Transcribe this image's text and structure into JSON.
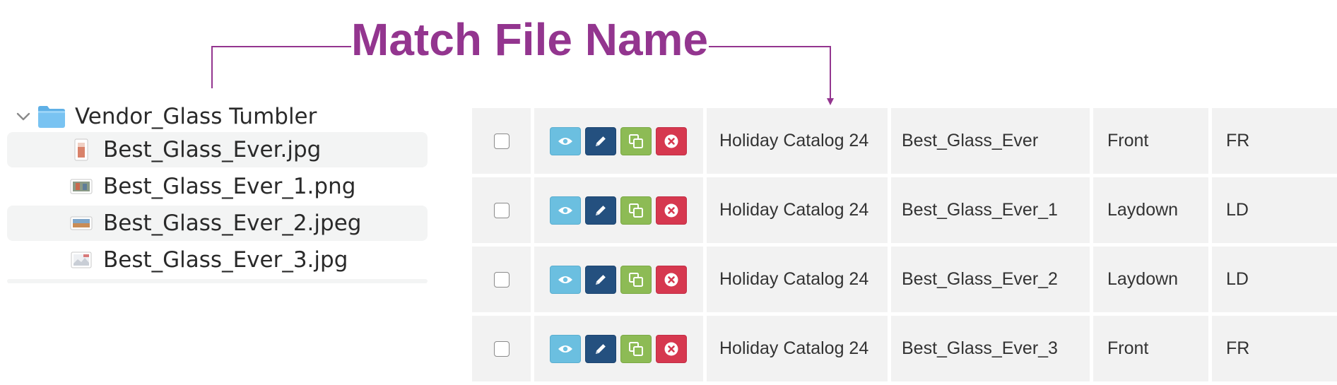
{
  "annotation": {
    "title": "Match File Name",
    "color": "#93358f"
  },
  "finder": {
    "folder": {
      "name": "Vendor_Glass Tumbler",
      "icon": "folder-icon",
      "expanded": true
    },
    "files": [
      {
        "name": "Best_Glass_Ever.jpg",
        "icon": "image-thumbnail-icon"
      },
      {
        "name": "Best_Glass_Ever_1.png",
        "icon": "image-thumbnail-icon"
      },
      {
        "name": "Best_Glass_Ever_2.jpeg",
        "icon": "image-thumbnail-icon"
      },
      {
        "name": "Best_Glass_Ever_3.jpg",
        "icon": "image-thumbnail-icon"
      }
    ]
  },
  "table": {
    "action_icons": [
      "eye-icon",
      "pencil-icon",
      "copy-icon",
      "close-circle-icon"
    ],
    "action_colors": {
      "view": "#6bbfe0",
      "edit": "#24507f",
      "copy": "#8dbb55",
      "delete": "#d6384f"
    },
    "rows": [
      {
        "catalog": "Holiday Catalog 24",
        "file_name": "Best_Glass_Ever",
        "view": "Front",
        "code": "FR"
      },
      {
        "catalog": "Holiday Catalog 24",
        "file_name": "Best_Glass_Ever_1",
        "view": "Laydown",
        "code": "LD"
      },
      {
        "catalog": "Holiday Catalog 24",
        "file_name": "Best_Glass_Ever_2",
        "view": "Laydown",
        "code": "LD"
      },
      {
        "catalog": "Holiday Catalog 24",
        "file_name": "Best_Glass_Ever_3",
        "view": "Front",
        "code": "FR"
      }
    ]
  }
}
